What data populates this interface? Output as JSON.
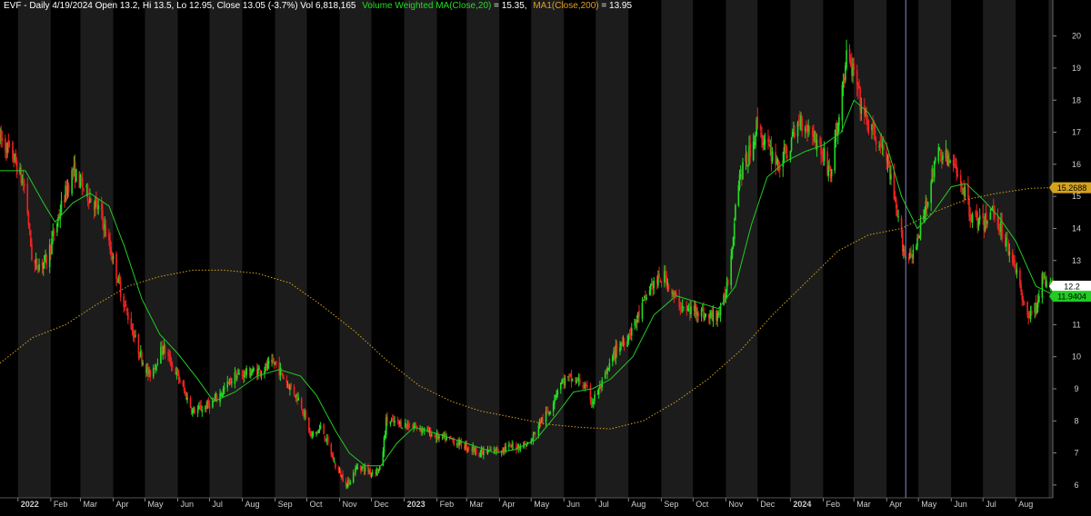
{
  "header": {
    "title_info": "EVF - Daily 4/19/2024 Open 13.2, Hi 13.5, Lo 12.95, Close 13.05 (-3.7%) Vol 6,818,165",
    "vwma_label": "Volume Weighted MA(Close,20)",
    "vwma_value": " = 15.35,",
    "ma_label": "MA1(Close,200)",
    "ma_value": " = 13.95"
  },
  "colors": {
    "background": "#000000",
    "band_light": "#1c1c1c",
    "band_dark": "#000000",
    "up": "#22dd22",
    "down": "#ee2222",
    "vwma": "#22cc22",
    "ma200": "#d4a21c",
    "cursor": "#8888cc",
    "header_text": "#ffffff",
    "header_green": "#22dd22",
    "header_orange": "#e0a020"
  },
  "chart_data": {
    "type": "candlestick",
    "symbol": "EVF",
    "y_axis": {
      "ticks": [
        6,
        7,
        8,
        9,
        10,
        11,
        12,
        13,
        14,
        15,
        16,
        17,
        18,
        19,
        20
      ],
      "range": [
        5.6,
        20.5
      ]
    },
    "x_axis": {
      "labels": [
        "2022",
        "Feb",
        "Mar",
        "Apr",
        "May",
        "Jun",
        "Jul",
        "Aug",
        "Sep",
        "Oct",
        "Nov",
        "Dec",
        "2023",
        "Feb",
        "Mar",
        "Apr",
        "May",
        "Jun",
        "Jul",
        "Aug",
        "Sep",
        "Oct",
        "Nov",
        "Dec",
        "2024",
        "Feb",
        "Mar",
        "Apr",
        "May",
        "Jun",
        "Jul",
        "Aug"
      ],
      "start": "2021-12-15",
      "end": "2024-09-05"
    },
    "cursor_date": "2024-04-19",
    "last_price": {
      "label": "12.2",
      "value": 12.2
    },
    "vwma_last": {
      "label": "11.9404",
      "value": 11.9404
    },
    "ma200_last": {
      "label": "15.2688",
      "value": 15.2688
    },
    "price_path": [
      [
        "2021-12-15",
        16.8
      ],
      [
        "2021-12-28",
        16.2
      ],
      [
        "2022-01-08",
        15.2
      ],
      [
        "2022-01-15",
        12.8
      ],
      [
        "2022-01-28",
        13.0
      ],
      [
        "2022-02-12",
        14.8
      ],
      [
        "2022-02-22",
        15.8
      ],
      [
        "2022-03-05",
        15.2
      ],
      [
        "2022-03-20",
        14.5
      ],
      [
        "2022-04-01",
        13.0
      ],
      [
        "2022-04-10",
        11.8
      ],
      [
        "2022-04-25",
        10.2
      ],
      [
        "2022-05-05",
        9.4
      ],
      [
        "2022-05-18",
        10.3
      ],
      [
        "2022-06-01",
        9.4
      ],
      [
        "2022-06-15",
        8.3
      ],
      [
        "2022-06-25",
        8.4
      ],
      [
        "2022-07-05",
        8.6
      ],
      [
        "2022-07-25",
        9.4
      ],
      [
        "2022-08-20",
        9.6
      ],
      [
        "2022-09-01",
        9.8
      ],
      [
        "2022-09-10",
        9.3
      ],
      [
        "2022-09-25",
        8.6
      ],
      [
        "2022-10-05",
        7.5
      ],
      [
        "2022-10-15",
        7.8
      ],
      [
        "2022-10-28",
        6.6
      ],
      [
        "2022-11-08",
        6.0
      ],
      [
        "2022-11-18",
        6.6
      ],
      [
        "2022-12-01",
        6.4
      ],
      [
        "2022-12-10",
        6.5
      ],
      [
        "2022-12-15",
        8.0
      ],
      [
        "2022-12-30",
        7.9
      ],
      [
        "2023-01-15",
        7.8
      ],
      [
        "2023-02-01",
        7.5
      ],
      [
        "2023-02-15",
        7.4
      ],
      [
        "2023-03-01",
        7.2
      ],
      [
        "2023-03-15",
        7.0
      ],
      [
        "2023-03-30",
        7.1
      ],
      [
        "2023-04-15",
        7.2
      ],
      [
        "2023-04-30",
        7.3
      ],
      [
        "2023-05-10",
        8.0
      ],
      [
        "2023-05-18",
        8.3
      ],
      [
        "2023-05-28",
        9.2
      ],
      [
        "2023-06-05",
        9.3
      ],
      [
        "2023-06-18",
        9.2
      ],
      [
        "2023-06-28",
        8.6
      ],
      [
        "2023-07-08",
        9.2
      ],
      [
        "2023-07-20",
        10.2
      ],
      [
        "2023-07-30",
        10.6
      ],
      [
        "2023-08-08",
        11.1
      ],
      [
        "2023-08-22",
        12.2
      ],
      [
        "2023-09-05",
        12.5
      ],
      [
        "2023-09-12",
        11.9
      ],
      [
        "2023-09-25",
        11.4
      ],
      [
        "2023-10-05",
        11.5
      ],
      [
        "2023-10-15",
        11.2
      ],
      [
        "2023-10-28",
        11.4
      ],
      [
        "2023-11-05",
        12.8
      ],
      [
        "2023-11-12",
        15.5
      ],
      [
        "2023-11-22",
        16.2
      ],
      [
        "2023-12-01",
        17.3
      ],
      [
        "2023-12-08",
        16.6
      ],
      [
        "2023-12-22",
        16.0
      ],
      [
        "2024-01-01",
        16.6
      ],
      [
        "2024-01-10",
        17.4
      ],
      [
        "2024-01-22",
        17.0
      ],
      [
        "2024-02-01",
        16.3
      ],
      [
        "2024-02-08",
        15.7
      ],
      [
        "2024-02-15",
        17.3
      ],
      [
        "2024-02-23",
        19.3
      ],
      [
        "2024-03-01",
        18.8
      ],
      [
        "2024-03-10",
        17.5
      ],
      [
        "2024-03-22",
        16.8
      ],
      [
        "2024-04-01",
        16.2
      ],
      [
        "2024-04-10",
        14.5
      ],
      [
        "2024-04-19",
        13.05
      ],
      [
        "2024-04-30",
        13.5
      ],
      [
        "2024-05-08",
        14.8
      ],
      [
        "2024-05-20",
        16.4
      ],
      [
        "2024-05-30",
        16.1
      ],
      [
        "2024-06-10",
        15.5
      ],
      [
        "2024-06-20",
        14.4
      ],
      [
        "2024-07-01",
        14.1
      ],
      [
        "2024-07-10",
        14.6
      ],
      [
        "2024-07-22",
        13.7
      ],
      [
        "2024-08-01",
        12.8
      ],
      [
        "2024-08-10",
        11.3
      ],
      [
        "2024-08-20",
        11.5
      ],
      [
        "2024-08-25",
        12.4
      ],
      [
        "2024-09-05",
        12.2
      ]
    ],
    "vwma_path": [
      [
        "2021-12-15",
        15.8
      ],
      [
        "2022-01-08",
        15.8
      ],
      [
        "2022-01-25",
        14.8
      ],
      [
        "2022-02-05",
        14.2
      ],
      [
        "2022-02-22",
        14.8
      ],
      [
        "2022-03-10",
        15.1
      ],
      [
        "2022-03-28",
        14.7
      ],
      [
        "2022-04-12",
        13.4
      ],
      [
        "2022-04-28",
        11.8
      ],
      [
        "2022-05-15",
        10.7
      ],
      [
        "2022-06-01",
        10.1
      ],
      [
        "2022-06-20",
        9.3
      ],
      [
        "2022-07-05",
        8.6
      ],
      [
        "2022-07-25",
        8.9
      ],
      [
        "2022-08-15",
        9.4
      ],
      [
        "2022-09-05",
        9.6
      ],
      [
        "2022-09-25",
        9.4
      ],
      [
        "2022-10-10",
        8.8
      ],
      [
        "2022-10-28",
        7.7
      ],
      [
        "2022-11-10",
        7.0
      ],
      [
        "2022-11-25",
        6.6
      ],
      [
        "2022-12-10",
        6.6
      ],
      [
        "2022-12-25",
        7.3
      ],
      [
        "2023-01-10",
        7.8
      ],
      [
        "2023-02-01",
        7.6
      ],
      [
        "2023-03-01",
        7.3
      ],
      [
        "2023-03-28",
        7.0
      ],
      [
        "2023-04-15",
        7.1
      ],
      [
        "2023-05-05",
        7.4
      ],
      [
        "2023-05-25",
        8.2
      ],
      [
        "2023-06-10",
        8.9
      ],
      [
        "2023-06-28",
        9.0
      ],
      [
        "2023-07-15",
        9.3
      ],
      [
        "2023-08-05",
        10.0
      ],
      [
        "2023-08-25",
        11.3
      ],
      [
        "2023-09-15",
        11.9
      ],
      [
        "2023-10-05",
        11.7
      ],
      [
        "2023-10-25",
        11.5
      ],
      [
        "2023-11-10",
        12.2
      ],
      [
        "2023-11-25",
        14.1
      ],
      [
        "2023-12-10",
        15.6
      ],
      [
        "2023-12-28",
        16.1
      ],
      [
        "2024-01-15",
        16.4
      ],
      [
        "2024-02-01",
        16.6
      ],
      [
        "2024-02-18",
        17.0
      ],
      [
        "2024-03-01",
        18.0
      ],
      [
        "2024-03-15",
        17.6
      ],
      [
        "2024-04-01",
        16.6
      ],
      [
        "2024-04-15",
        15.0
      ],
      [
        "2024-04-30",
        14.0
      ],
      [
        "2024-05-15",
        14.5
      ],
      [
        "2024-06-01",
        15.3
      ],
      [
        "2024-06-15",
        15.4
      ],
      [
        "2024-07-01",
        14.9
      ],
      [
        "2024-07-15",
        14.4
      ],
      [
        "2024-08-01",
        13.6
      ],
      [
        "2024-08-20",
        12.2
      ],
      [
        "2024-09-05",
        11.94
      ]
    ],
    "ma200_path": [
      [
        "2021-12-15",
        9.8
      ],
      [
        "2022-01-15",
        10.6
      ],
      [
        "2022-02-15",
        11.0
      ],
      [
        "2022-03-15",
        11.6
      ],
      [
        "2022-04-15",
        12.2
      ],
      [
        "2022-05-15",
        12.5
      ],
      [
        "2022-06-15",
        12.7
      ],
      [
        "2022-07-15",
        12.7
      ],
      [
        "2022-08-15",
        12.6
      ],
      [
        "2022-09-15",
        12.3
      ],
      [
        "2022-10-15",
        11.6
      ],
      [
        "2022-11-15",
        10.8
      ],
      [
        "2022-12-15",
        9.9
      ],
      [
        "2023-01-15",
        9.1
      ],
      [
        "2023-02-15",
        8.6
      ],
      [
        "2023-03-15",
        8.3
      ],
      [
        "2023-04-15",
        8.1
      ],
      [
        "2023-05-15",
        7.9
      ],
      [
        "2023-06-15",
        7.8
      ],
      [
        "2023-07-15",
        7.75
      ],
      [
        "2023-08-15",
        8.0
      ],
      [
        "2023-09-15",
        8.6
      ],
      [
        "2023-10-15",
        9.3
      ],
      [
        "2023-11-15",
        10.2
      ],
      [
        "2023-12-15",
        11.3
      ],
      [
        "2024-01-15",
        12.3
      ],
      [
        "2024-02-15",
        13.3
      ],
      [
        "2024-03-15",
        13.8
      ],
      [
        "2024-04-15",
        14.0
      ],
      [
        "2024-05-15",
        14.5
      ],
      [
        "2024-06-15",
        14.9
      ],
      [
        "2024-07-15",
        15.1
      ],
      [
        "2024-08-15",
        15.25
      ],
      [
        "2024-09-05",
        15.27
      ]
    ]
  }
}
